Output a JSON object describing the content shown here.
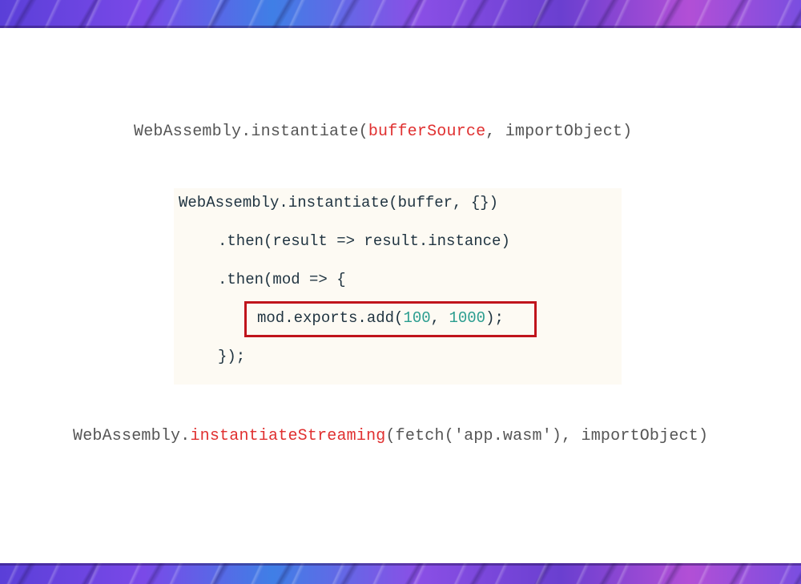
{
  "slide": {
    "signature_1": {
      "prefix": "WebAssembly.instantiate(",
      "highlight": "bufferSource",
      "suffix": ", importObject)"
    },
    "code_block": {
      "line_1": "WebAssembly.instantiate(buffer, {})",
      "line_2": ".then(result => result.instance)",
      "line_3": ".then(mod => {",
      "line_4": {
        "prefix": "mod.exports.add(",
        "num_1": "100",
        "sep": ", ",
        "num_2": "1000",
        "suffix": ");"
      },
      "line_5": "});"
    },
    "signature_2": {
      "prefix": "WebAssembly.",
      "highlight": "instantiateStreaming",
      "suffix": "(fetch('app.wasm'), importObject)"
    }
  },
  "colors": {
    "highlight_text": "#e03030",
    "code_text": "#1f3340",
    "number_text": "#2a9d8f",
    "highlight_box": "#c0141c",
    "code_background": "#fdfaf3"
  }
}
